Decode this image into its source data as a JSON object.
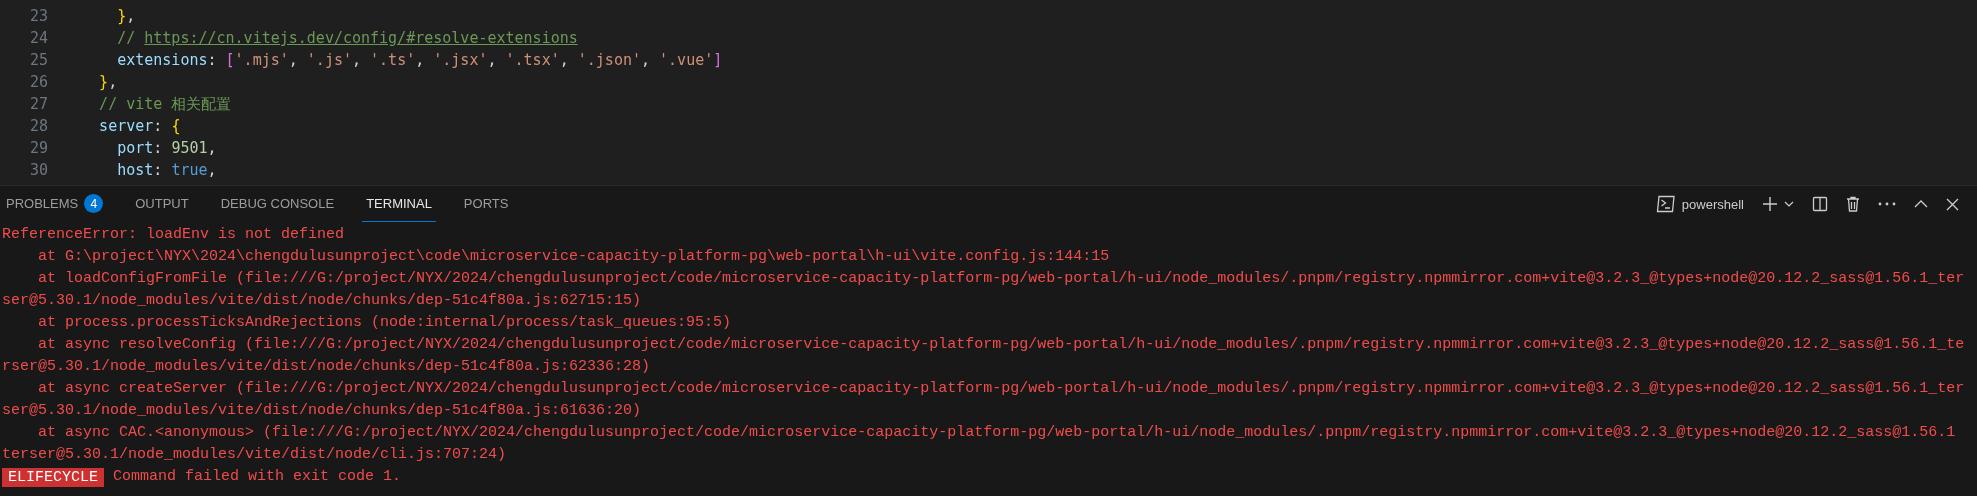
{
  "editor": {
    "lines": [
      {
        "number": "23",
        "tokens": [
          {
            "text": "      }",
            "kind": "brace"
          },
          {
            "text": ",",
            "kind": "plain"
          }
        ]
      },
      {
        "number": "24",
        "tokens": [
          {
            "text": "      // ",
            "kind": "comment"
          },
          {
            "text": "https://cn.vitejs.dev/config/#resolve-extensions",
            "kind": "link"
          }
        ]
      },
      {
        "number": "25",
        "tokens": [
          {
            "text": "      extensions",
            "kind": "key"
          },
          {
            "text": ": ",
            "kind": "plain"
          },
          {
            "text": "[",
            "kind": "bracket"
          },
          {
            "text": "'.mjs'",
            "kind": "string"
          },
          {
            "text": ", ",
            "kind": "plain"
          },
          {
            "text": "'.js'",
            "kind": "string"
          },
          {
            "text": ", ",
            "kind": "plain"
          },
          {
            "text": "'.ts'",
            "kind": "string"
          },
          {
            "text": ", ",
            "kind": "plain"
          },
          {
            "text": "'.jsx'",
            "kind": "string"
          },
          {
            "text": ", ",
            "kind": "plain"
          },
          {
            "text": "'.tsx'",
            "kind": "string"
          },
          {
            "text": ", ",
            "kind": "plain"
          },
          {
            "text": "'.json'",
            "kind": "string"
          },
          {
            "text": ", ",
            "kind": "plain"
          },
          {
            "text": "'.vue'",
            "kind": "string"
          },
          {
            "text": "]",
            "kind": "bracket"
          }
        ]
      },
      {
        "number": "26",
        "tokens": [
          {
            "text": "    }",
            "kind": "brace"
          },
          {
            "text": ",",
            "kind": "plain"
          }
        ]
      },
      {
        "number": "27",
        "tokens": [
          {
            "text": "    // vite 相关配置",
            "kind": "comment"
          }
        ]
      },
      {
        "number": "28",
        "tokens": [
          {
            "text": "    server",
            "kind": "key"
          },
          {
            "text": ": ",
            "kind": "plain"
          },
          {
            "text": "{",
            "kind": "brace"
          }
        ]
      },
      {
        "number": "29",
        "tokens": [
          {
            "text": "      port",
            "kind": "key"
          },
          {
            "text": ": ",
            "kind": "plain"
          },
          {
            "text": "9501",
            "kind": "number"
          },
          {
            "text": ",",
            "kind": "plain"
          }
        ]
      },
      {
        "number": "30",
        "tokens": [
          {
            "text": "      host",
            "kind": "key"
          },
          {
            "text": ": ",
            "kind": "plain"
          },
          {
            "text": "true",
            "kind": "keyword"
          },
          {
            "text": ",",
            "kind": "plain"
          }
        ]
      }
    ]
  },
  "panel": {
    "tabs": [
      {
        "label": "PROBLEMS",
        "badge": "4",
        "selected": false
      },
      {
        "label": "OUTPUT",
        "selected": false
      },
      {
        "label": "DEBUG CONSOLE",
        "selected": false
      },
      {
        "label": "TERMINAL",
        "selected": true
      },
      {
        "label": "PORTS",
        "selected": false
      }
    ],
    "shell": "powershell"
  },
  "terminal": {
    "lines": [
      {
        "kind": "text",
        "text": "ReferenceError: loadEnv is not defined"
      },
      {
        "kind": "text",
        "text": "    at G:\\project\\NYX\\2024\\chengdulusunproject\\code\\microservice-capacity-platform-pg\\web-portal\\h-ui\\vite.config.js:144:15"
      },
      {
        "kind": "text",
        "text": "    at loadConfigFromFile (file:///G:/project/NYX/2024/chengdulusunproject/code/microservice-capacity-platform-pg/web-portal/h-ui/node_modules/.pnpm/registry.npmmirror.com+vite@3.2.3_@types+node@20.12.2_sass@1.56.1_ter"
      },
      {
        "kind": "text",
        "text": "ser@5.30.1/node_modules/vite/dist/node/chunks/dep-51c4f80a.js:62715:15)"
      },
      {
        "kind": "text",
        "text": "    at process.processTicksAndRejections (node:internal/process/task_queues:95:5)"
      },
      {
        "kind": "text",
        "text": "    at async resolveConfig (file:///G:/project/NYX/2024/chengdulusunproject/code/microservice-capacity-platform-pg/web-portal/h-ui/node_modules/.pnpm/registry.npmmirror.com+vite@3.2.3_@types+node@20.12.2_sass@1.56.1_te"
      },
      {
        "kind": "text",
        "text": "rser@5.30.1/node_modules/vite/dist/node/chunks/dep-51c4f80a.js:62336:28)"
      },
      {
        "kind": "text",
        "text": "    at async createServer (file:///G:/project/NYX/2024/chengdulusunproject/code/microservice-capacity-platform-pg/web-portal/h-ui/node_modules/.pnpm/registry.npmmirror.com+vite@3.2.3_@types+node@20.12.2_sass@1.56.1_ter"
      },
      {
        "kind": "text",
        "text": "ser@5.30.1/node_modules/vite/dist/node/chunks/dep-51c4f80a.js:61636:20)"
      },
      {
        "kind": "text",
        "text": "    at async CAC.<anonymous> (file:///G:/project/NYX/2024/chengdulusunproject/code/microservice-capacity-platform-pg/web-portal/h-ui/node_modules/.pnpm/registry.npmmirror.com+vite@3.2.3_@types+node@20.12.2_sass@1.56.1"
      },
      {
        "kind": "text",
        "text": "terser@5.30.1/node_modules/vite/dist/node/cli.js:707:24)"
      },
      {
        "kind": "status",
        "tag": "ELIFECYCLE",
        "text": "Command failed with exit code 1."
      }
    ]
  }
}
